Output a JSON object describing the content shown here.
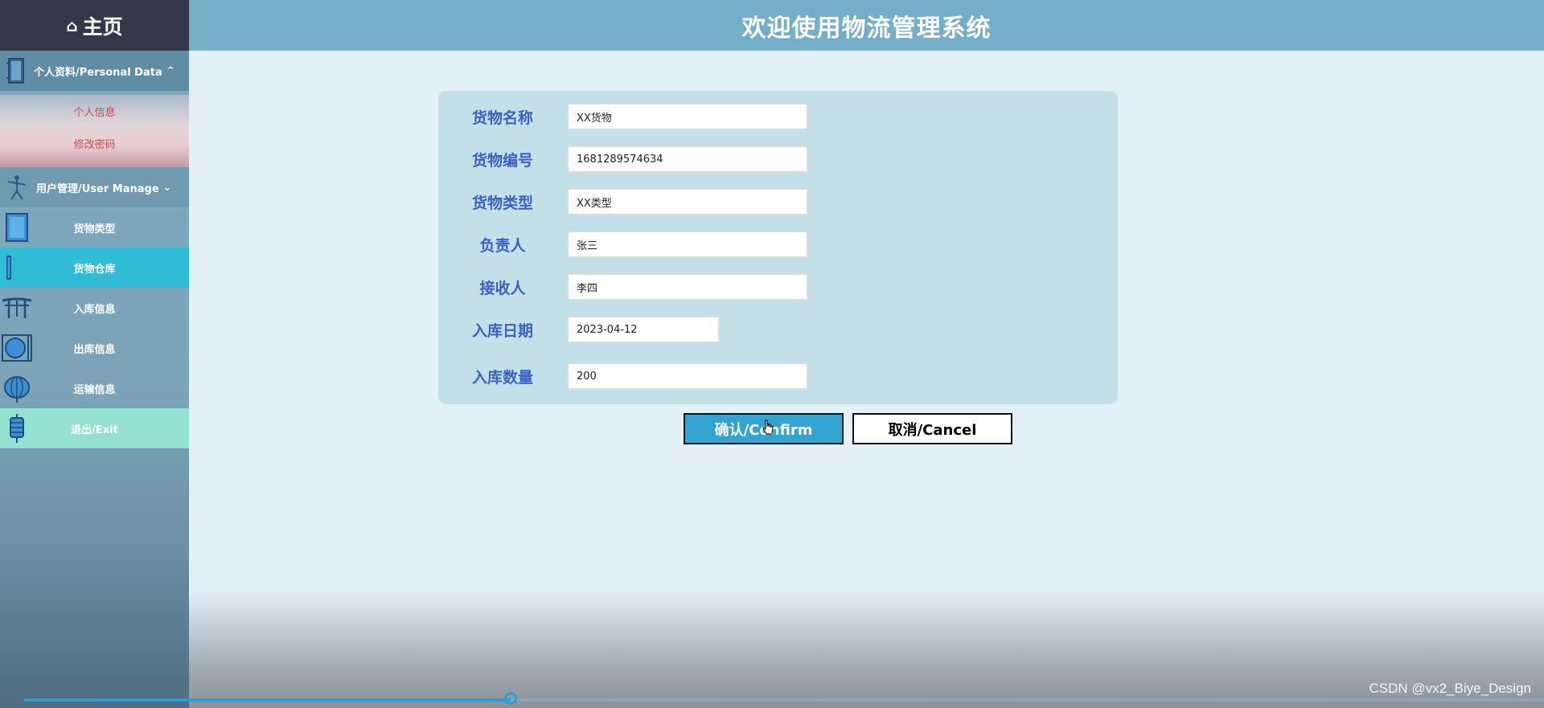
{
  "sidebar": {
    "home_label": "主页",
    "home_icon": "home-icon",
    "personal_group": {
      "label": "个人资料/Personal Data",
      "expanded": true
    },
    "personal_items": [
      {
        "label": "个人信息"
      },
      {
        "label": "修改密码"
      }
    ],
    "user_group": {
      "label": "用户管理/User Manage",
      "expanded": true
    },
    "items": [
      {
        "label": "货物类型",
        "icon": "panel-icon"
      },
      {
        "label": "货物仓库",
        "icon": "bar-icon",
        "active": true
      },
      {
        "label": "入库信息",
        "icon": "gate-icon"
      },
      {
        "label": "出库信息",
        "icon": "circle-frame-icon"
      },
      {
        "label": "运输信息",
        "icon": "lantern-icon"
      },
      {
        "label": "退出/Exit",
        "icon": "hanging-lantern-icon"
      }
    ]
  },
  "header": {
    "title": "欢迎使用物流管理系统"
  },
  "form": {
    "fields": [
      {
        "label": "货物名称",
        "value": "XX货物"
      },
      {
        "label": "货物编号",
        "value": "1681289574634"
      },
      {
        "label": "货物类型",
        "value": "XX类型"
      },
      {
        "label": "负责人",
        "value": "张三"
      },
      {
        "label": "接收人",
        "value": "李四"
      },
      {
        "label": "入库日期",
        "value": "2023-04-12"
      },
      {
        "label": "入库数量",
        "value": "200"
      }
    ],
    "confirm_label": "确认/Confirm",
    "cancel_label": "取消/Cancel"
  },
  "video_progress": 0.32,
  "watermark": "CSDN @vx2_Biye_Design",
  "colors": {
    "accent": "#32a4cf",
    "active_item": "#30bcd4",
    "label_blue": "#3a62c4",
    "header_bg": "#74aec9"
  }
}
